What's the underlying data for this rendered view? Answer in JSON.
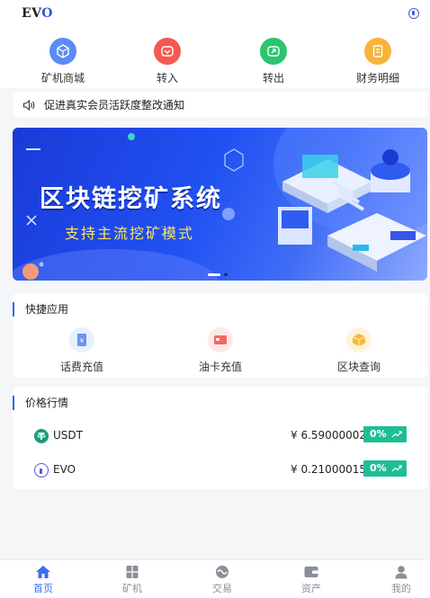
{
  "header": {
    "logo_text": "EV",
    "logo_accent": "O",
    "avatar_icon": "user-circle-icon"
  },
  "quick_menu": [
    {
      "label": "矿机商城",
      "icon": "mining-store-icon",
      "color": "#5b8cf5"
    },
    {
      "label": "转入",
      "icon": "transfer-in-icon",
      "color": "#f45a4f"
    },
    {
      "label": "转出",
      "icon": "transfer-out-icon",
      "color": "#2cc46d"
    },
    {
      "label": "财务明细",
      "icon": "finance-detail-icon",
      "color": "#f7b43c"
    }
  ],
  "notice": {
    "icon": "speaker-icon",
    "text": "促进真实会员活跃度整改通知"
  },
  "banner": {
    "title": "区块链挖矿系统",
    "subtitle": "支持主流挖矿模式",
    "slide_count": 2,
    "active_slide": 1
  },
  "shortcuts": {
    "title": "快捷应用",
    "items": [
      {
        "label": "话费充值",
        "icon": "phone-recharge-icon",
        "color": "#5b8cf5"
      },
      {
        "label": "油卡充值",
        "icon": "fuel-card-icon",
        "color": "#f45a4f"
      },
      {
        "label": "区块查询",
        "icon": "block-query-icon",
        "color": "#f7b43c"
      }
    ]
  },
  "market": {
    "title": "价格行情",
    "rows": [
      {
        "name": "USDT",
        "price": "¥ 6.59000002",
        "change": "0%",
        "icon": "usdt-icon",
        "trend_icon": "trend-up-icon"
      },
      {
        "name": "EVO",
        "price": "¥ 0.21000015",
        "change": "0%",
        "icon": "evo-icon",
        "trend_icon": "trend-up-icon"
      }
    ]
  },
  "tabbar": [
    {
      "label": "首页",
      "icon": "home-icon",
      "active": true
    },
    {
      "label": "矿机",
      "icon": "miner-icon",
      "active": false
    },
    {
      "label": "交易",
      "icon": "exchange-icon",
      "active": false
    },
    {
      "label": "资产",
      "icon": "wallet-icon",
      "active": false
    },
    {
      "label": "我的",
      "icon": "profile-icon",
      "active": false
    }
  ],
  "colors": {
    "accent": "#3a6ff0",
    "up": "#1ebe95",
    "tab_inactive": "#8a8f99"
  }
}
